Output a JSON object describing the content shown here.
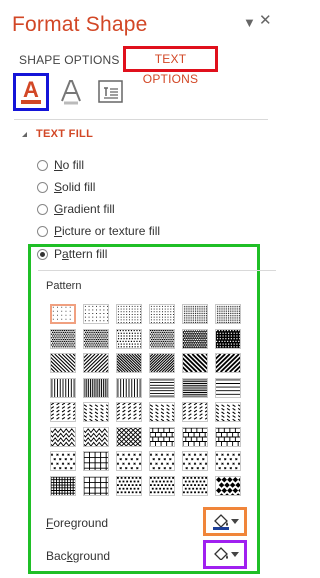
{
  "pane": {
    "title": "Format Shape",
    "dropdown_glyph": "▼",
    "close_glyph": "✕"
  },
  "tabs": {
    "shape_options": "SHAPE OPTIONS",
    "text_options": "TEXT OPTIONS"
  },
  "icons": {
    "text_fill_outline": "text-fill-outline-icon",
    "text_effects": "text-effects-icon",
    "text_box": "text-box-icon",
    "text_fill_letter": "A"
  },
  "section": {
    "title": "TEXT FILL"
  },
  "fill_options": [
    {
      "label": "No fill",
      "underline": "N",
      "rest": "o fill",
      "selected": false
    },
    {
      "label": "Solid fill",
      "underline": "S",
      "rest": "olid fill",
      "selected": false
    },
    {
      "label": "Gradient fill",
      "underline": "G",
      "rest": "radient fill",
      "selected": false
    },
    {
      "label": "Picture or texture fill",
      "underline": "P",
      "rest": "icture or texture fill",
      "selected": false
    },
    {
      "label": "Pattern fill",
      "underline": "P",
      "rest": "attern fill",
      "selected": true,
      "prefix": "",
      "u_index": 1
    }
  ],
  "pattern": {
    "label": "Pattern",
    "selected_index": 0,
    "count": 48
  },
  "colors": {
    "foreground_label": "Foreground",
    "foreground_underline": "F",
    "foreground_rest": "oreground",
    "background_label": "Background",
    "background_underline": "k",
    "foreground_border": "#f0853a",
    "background_border": "#a020f0",
    "accent": "#d24726",
    "tab_highlight": "#e0101c",
    "icon_highlight": "#1414d8",
    "pattern_box": "#1fbf26"
  }
}
